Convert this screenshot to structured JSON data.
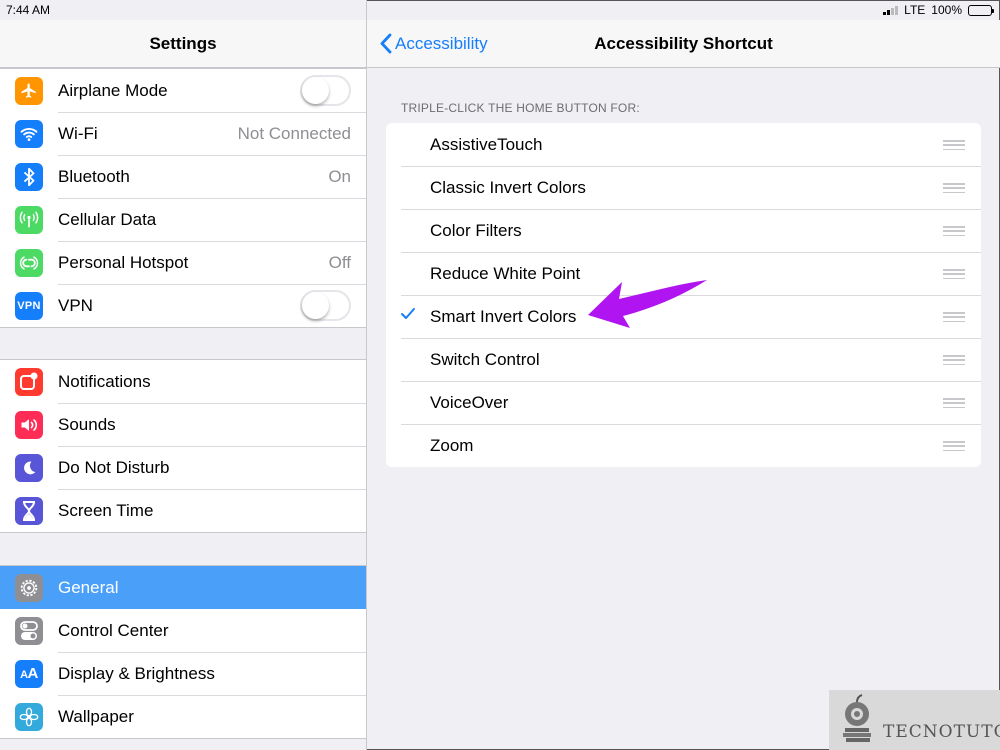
{
  "status_bar": {
    "time": "7:44 AM",
    "carrier": "LTE",
    "battery": "100%"
  },
  "sidebar": {
    "title": "Settings",
    "groups": [
      [
        {
          "label": "Airplane Mode",
          "icon": "airplane-icon",
          "color": "#ff9500",
          "accessory": "toggle",
          "on": false
        },
        {
          "label": "Wi-Fi",
          "icon": "wifi-icon",
          "color": "#147efb",
          "value": "Not Connected"
        },
        {
          "label": "Bluetooth",
          "icon": "bluetooth-icon",
          "color": "#147efb",
          "value": "On"
        },
        {
          "label": "Cellular Data",
          "icon": "cellular-icon",
          "color": "#4cd964"
        },
        {
          "label": "Personal Hotspot",
          "icon": "hotspot-icon",
          "color": "#4cd964",
          "value": "Off"
        },
        {
          "label": "VPN",
          "icon": "vpn-icon",
          "color": "#147efb",
          "accessory": "toggle",
          "on": false
        }
      ],
      [
        {
          "label": "Notifications",
          "icon": "notifications-icon",
          "color": "#ff3b30"
        },
        {
          "label": "Sounds",
          "icon": "sounds-icon",
          "color": "#ff2d55"
        },
        {
          "label": "Do Not Disturb",
          "icon": "moon-icon",
          "color": "#5856d6"
        },
        {
          "label": "Screen Time",
          "icon": "hourglass-icon",
          "color": "#5856d6"
        }
      ],
      [
        {
          "label": "General",
          "icon": "gear-icon",
          "color": "#8e8e93",
          "selected": true
        },
        {
          "label": "Control Center",
          "icon": "switches-icon",
          "color": "#8e8e93"
        },
        {
          "label": "Display & Brightness",
          "icon": "text-size-icon",
          "color": "#147efb"
        },
        {
          "label": "Wallpaper",
          "icon": "flower-icon",
          "color": "#34aadc"
        }
      ]
    ]
  },
  "detail": {
    "back_label": "Accessibility",
    "title": "Accessibility Shortcut",
    "section_header": "TRIPLE-CLICK THE HOME BUTTON FOR:",
    "options": [
      {
        "label": "AssistiveTouch",
        "checked": false
      },
      {
        "label": "Classic Invert Colors",
        "checked": false
      },
      {
        "label": "Color Filters",
        "checked": false
      },
      {
        "label": "Reduce White Point",
        "checked": false
      },
      {
        "label": "Smart Invert Colors",
        "checked": true
      },
      {
        "label": "Switch Control",
        "checked": false
      },
      {
        "label": "VoiceOver",
        "checked": false
      },
      {
        "label": "Zoom",
        "checked": false
      }
    ]
  },
  "annotation": {
    "arrow_color": "#b014f0"
  },
  "watermark": {
    "text": "TECNOTUTO"
  }
}
